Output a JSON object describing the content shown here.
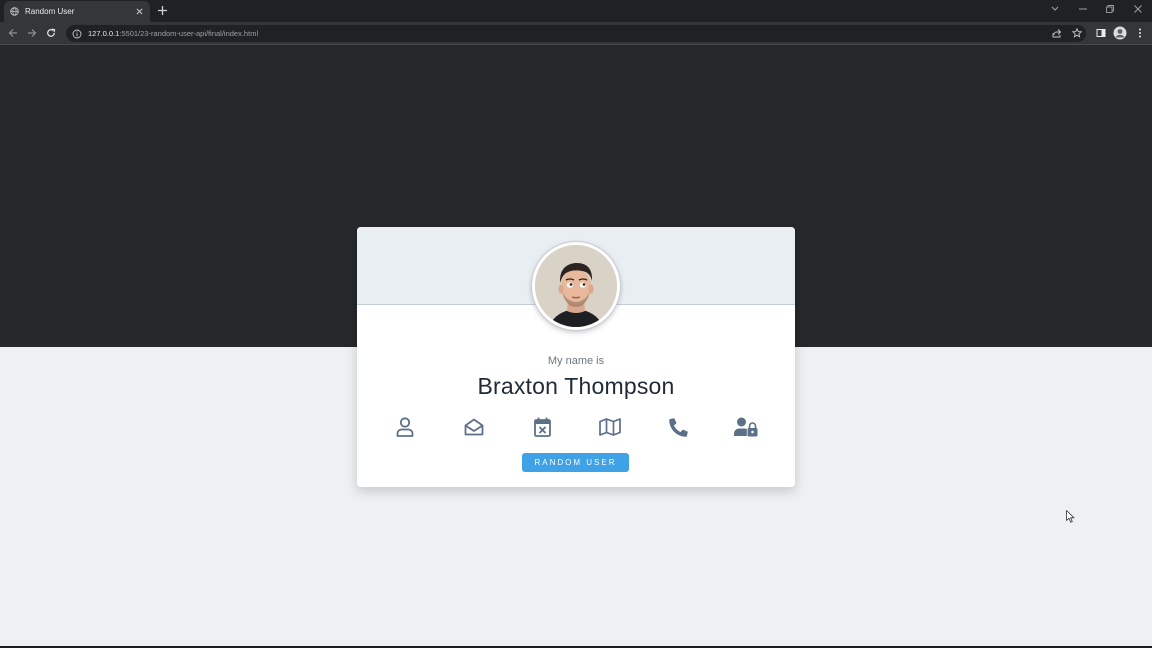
{
  "browser": {
    "tab_title": "Random User",
    "url_host": "127.0.0.1",
    "url_rest": ":5501/23-random-user-api/final/index.html"
  },
  "card": {
    "label": "My name is",
    "value": "Braxton Thompson",
    "icons": [
      "user-icon",
      "envelope-open-icon",
      "calendar-x-icon",
      "map-icon",
      "phone-icon",
      "user-lock-icon"
    ],
    "button_label": "random user"
  },
  "colors": {
    "page_top": "#26282c",
    "page_bottom": "#eef1f4",
    "icon": "#5c7087",
    "button": "#3fa1e6"
  }
}
